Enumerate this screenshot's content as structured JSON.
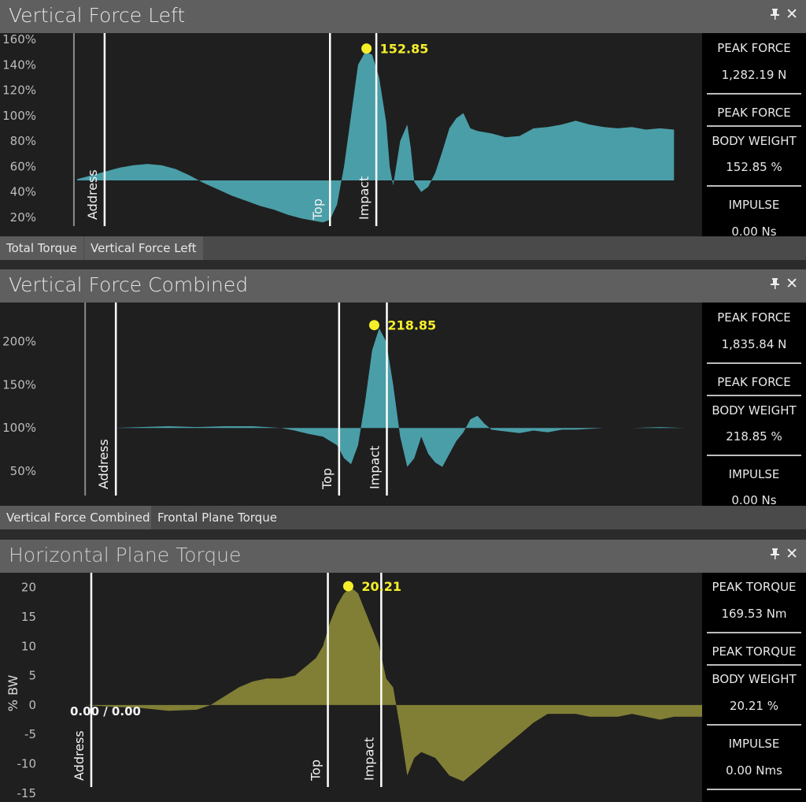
{
  "colors": {
    "teal": "#4a9ea8",
    "olive": "#807f35",
    "peak_marker": "#f5ef2a",
    "marker_line": "#ffffff"
  },
  "panels": [
    {
      "title": "Vertical Force Left",
      "pin_icon": "pin-icon",
      "close_icon": "close-icon",
      "close_glyph": "✕",
      "pin_glyph": "📌",
      "stats": {
        "peak_force_label": "PEAK FORCE",
        "peak_force_value": "1,282.19 N",
        "ratio_top": "PEAK FORCE",
        "ratio_bottom": "BODY WEIGHT",
        "ratio_value": "152.85  %",
        "impulse_label": "IMPULSE",
        "impulse_value": "0.00 Ns"
      },
      "tabs": [
        {
          "label": "Total Torque",
          "active": false
        },
        {
          "label": "Vertical Force Left",
          "active": true
        }
      ],
      "markers": [
        "Address",
        "Top",
        "Impact"
      ]
    },
    {
      "title": "Vertical Force Combined",
      "stats": {
        "peak_force_label": "PEAK FORCE",
        "peak_force_value": "1,835.84 N",
        "ratio_top": "PEAK FORCE",
        "ratio_bottom": "BODY WEIGHT",
        "ratio_value": "218.85  %",
        "impulse_label": "IMPULSE",
        "impulse_value": "0.00 Ns"
      },
      "tabs": [
        {
          "label": "Vertical Force Combined",
          "active": true
        },
        {
          "label": "Frontal Plane Torque",
          "active": false
        }
      ],
      "markers": [
        "Address",
        "Top",
        "Impact"
      ]
    },
    {
      "title": "Horizontal Plane Torque",
      "stats": {
        "peak_force_label": "PEAK TORQUE",
        "peak_force_value": "169.53 Nm",
        "ratio_top": "PEAK TORQUE",
        "ratio_bottom": "BODY WEIGHT",
        "ratio_value": "20.21  %",
        "impulse_label": "IMPULSE",
        "impulse_value": "0.00 Nms"
      },
      "markers": [
        "Address",
        "Top",
        "Impact"
      ],
      "zero_readout": "0.00 / 0.00"
    }
  ],
  "chart_data": [
    {
      "type": "area",
      "title": "Vertical Force Left",
      "ylabel": "",
      "ylim": [
        5,
        165
      ],
      "y_ticks": [
        "160%",
        "140%",
        "120%",
        "100%",
        "80%",
        "60%",
        "40%",
        "20%"
      ],
      "y_tick_values": [
        160,
        140,
        120,
        100,
        80,
        60,
        40,
        20
      ],
      "baseline": 49,
      "xlim": [
        0,
        100
      ],
      "markers": [
        {
          "label": "Address",
          "x": 14.9
        },
        {
          "label": "Top",
          "x": 47.0
        },
        {
          "label": "Impact",
          "x": 53.6
        }
      ],
      "peak": {
        "x": 52.2,
        "y": 152.85,
        "label": "152.85"
      },
      "x": [
        11,
        13,
        15,
        17,
        19,
        21,
        23,
        25,
        27,
        29,
        31,
        33,
        35,
        37,
        39,
        41,
        43,
        45,
        46,
        47,
        48,
        49,
        50,
        51,
        52,
        53,
        54,
        55,
        55.5,
        56,
        57,
        58,
        58.5,
        59,
        60,
        61,
        62,
        63,
        64,
        65,
        66,
        67,
        68,
        70,
        72,
        74,
        76,
        78,
        80,
        82,
        84,
        86,
        88,
        90,
        92,
        94,
        96
      ],
      "values": [
        50,
        53,
        56,
        59,
        61,
        62,
        61,
        58,
        53,
        47,
        42,
        37,
        33,
        29,
        26,
        22,
        19,
        17,
        16,
        18,
        30,
        60,
        100,
        140,
        150,
        148,
        130,
        95,
        60,
        45,
        80,
        93,
        75,
        48,
        40,
        44,
        55,
        72,
        90,
        98,
        102,
        90,
        88,
        86,
        83,
        84,
        90,
        91,
        93,
        96,
        93,
        91,
        90,
        91,
        89,
        90,
        89
      ]
    },
    {
      "type": "area",
      "title": "Vertical Force Combined",
      "ylabel": "",
      "ylim": [
        10,
        245
      ],
      "y_ticks": [
        "200%",
        "150%",
        "100%",
        "50%"
      ],
      "y_tick_values": [
        200,
        150,
        100,
        50
      ],
      "baseline": 100,
      "xlim": [
        0,
        100
      ],
      "markers": [
        {
          "label": "Address",
          "x": 16.5
        },
        {
          "label": "Top",
          "x": 48.3
        },
        {
          "label": "Impact",
          "x": 55.1
        }
      ],
      "peak": {
        "x": 53.3,
        "y": 218.85,
        "label": "218.85"
      },
      "x": [
        12.5,
        16,
        20,
        24,
        28,
        32,
        36,
        40,
        42,
        44,
        46,
        48,
        49,
        50,
        51,
        52,
        53,
        54,
        55,
        56,
        57,
        58,
        59,
        60,
        61,
        62,
        63,
        64,
        65,
        66,
        67,
        68,
        69,
        70,
        72,
        74,
        76,
        78,
        80,
        82,
        86,
        90,
        94,
        97.5
      ],
      "values": [
        100,
        100,
        101,
        102,
        101,
        102,
        102,
        100,
        97,
        93,
        90,
        80,
        65,
        58,
        80,
        130,
        190,
        215,
        200,
        150,
        90,
        55,
        65,
        90,
        70,
        60,
        55,
        70,
        85,
        95,
        110,
        114,
        105,
        98,
        96,
        94,
        97,
        95,
        98,
        98,
        100,
        100,
        101,
        100
      ]
    },
    {
      "type": "area",
      "title": "Horizontal Plane Torque",
      "ylabel": "% BW",
      "ylim": [
        -16.5,
        22.5
      ],
      "y_ticks": [
        "20",
        "15",
        "10",
        "5",
        "0",
        "-5",
        "-10",
        "-15"
      ],
      "y_tick_values": [
        20,
        15,
        10,
        5,
        0,
        -5,
        -10,
        -15
      ],
      "baseline": 0,
      "xlim": [
        0,
        100
      ],
      "markers": [
        {
          "label": "Address",
          "x": 13.0
        },
        {
          "label": "Top",
          "x": 46.7
        },
        {
          "label": "Impact",
          "x": 54.3
        }
      ],
      "peak": {
        "x": 49.6,
        "y": 20.21,
        "label": "20.21"
      },
      "zero_label": "0.00 / 0.00",
      "x": [
        8,
        12,
        16,
        20,
        24,
        28,
        30,
        32,
        34,
        36,
        38,
        40,
        42,
        44,
        45,
        46,
        47,
        48,
        49,
        50,
        51,
        52,
        53,
        54,
        55,
        56,
        57,
        58,
        59,
        60,
        62,
        64,
        66,
        68,
        70,
        72,
        74,
        76,
        78,
        80,
        82,
        84,
        86,
        88,
        90,
        92,
        94,
        96,
        98,
        100
      ],
      "values": [
        0,
        0,
        -0.3,
        -0.5,
        -1,
        -0.8,
        0,
        1.5,
        3,
        4,
        4.5,
        4.5,
        5,
        7,
        8,
        10,
        14,
        17,
        19,
        20,
        19,
        16,
        13,
        10,
        4.5,
        3,
        -4,
        -12,
        -9,
        -8,
        -9,
        -12,
        -13,
        -11,
        -9,
        -7,
        -5,
        -3,
        -1.5,
        -1.5,
        -1.5,
        -2,
        -2,
        -2,
        -1.5,
        -2,
        -2.5,
        -2,
        -2,
        -2
      ]
    }
  ]
}
